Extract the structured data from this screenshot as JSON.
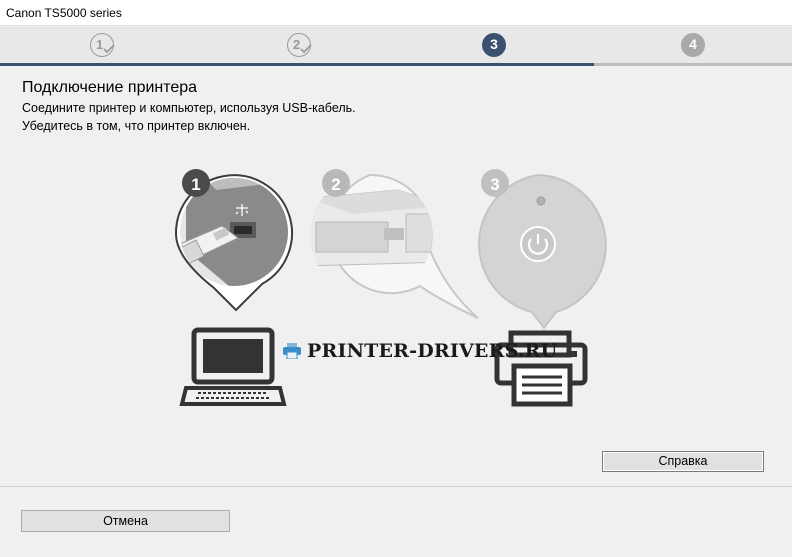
{
  "window": {
    "title": "Canon TS5000 series"
  },
  "steps": [
    {
      "number": "1",
      "state": "done"
    },
    {
      "number": "2",
      "state": "done"
    },
    {
      "number": "3",
      "state": "active"
    },
    {
      "number": "4",
      "state": "upcoming"
    }
  ],
  "main": {
    "heading": "Подключение принтера",
    "line1": "Соедините принтер и компьютер, используя USB-кабель.",
    "line2": "Убедитесь в том, что принтер включен."
  },
  "illustration": {
    "badge1": "1",
    "badge2": "2",
    "badge3": "3"
  },
  "watermark": {
    "text": "PRINTER-DRIVERS.RU"
  },
  "buttons": {
    "help": "Справка",
    "cancel": "Отмена"
  },
  "colors": {
    "accent": "#3a5170",
    "inactive": "#a9a9a9"
  }
}
